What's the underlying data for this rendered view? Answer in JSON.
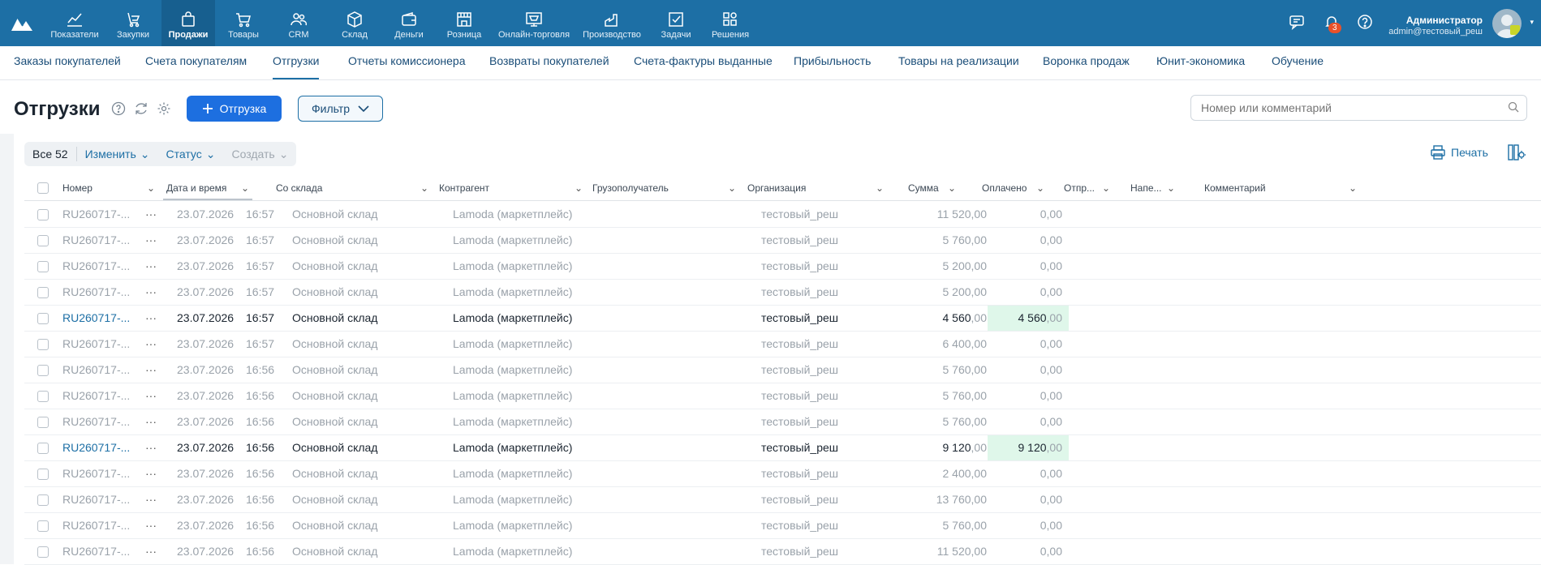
{
  "topnav": {
    "items": [
      {
        "label": "Показатели",
        "icon": "chart-line-icon"
      },
      {
        "label": "Закупки",
        "icon": "purchase-icon"
      },
      {
        "label": "Продажи",
        "icon": "bag-icon"
      },
      {
        "label": "Товары",
        "icon": "cart-icon"
      },
      {
        "label": "CRM",
        "icon": "people-icon"
      },
      {
        "label": "Склад",
        "icon": "box-icon"
      },
      {
        "label": "Деньги",
        "icon": "wallet-icon"
      },
      {
        "label": "Розница",
        "icon": "store-icon"
      },
      {
        "label": "Онлайн-торговля",
        "icon": "online-store-icon"
      },
      {
        "label": "Производство",
        "icon": "factory-icon"
      },
      {
        "label": "Задачи",
        "icon": "checkbox-icon"
      },
      {
        "label": "Решения",
        "icon": "apps-icon"
      }
    ],
    "notifications_count": "3",
    "user_name": "Администратор",
    "user_email": "admin@тестовый_реш"
  },
  "subnav": {
    "items": [
      "Заказы покупателей",
      "Счета покупателям",
      "Отгрузки",
      "Отчеты комиссионера",
      "Возвраты покупателей",
      "Счета-фактуры выданные",
      "Прибыльность",
      "Товары на реализации",
      "Воронка продаж",
      "Юнит-экономика",
      "Обучение"
    ]
  },
  "page": {
    "title": "Отгрузки",
    "add_button": "Отгрузка",
    "filter_button": "Фильтр",
    "search_placeholder": "Номер или комментарий"
  },
  "toolbar": {
    "all_label": "Все 52",
    "edit_label": "Изменить",
    "status_label": "Статус",
    "create_label": "Создать",
    "print_label": "Печать"
  },
  "columns": [
    "Номер",
    "Дата и время",
    "Со склада",
    "Контрагент",
    "Грузополучатель",
    "Организация",
    "Сумма",
    "Оплачено",
    "Отпр...",
    "Напе...",
    "Комментарий"
  ],
  "rows": [
    {
      "number": "RU260717-...",
      "date": "23.07.2026",
      "time": "16:57",
      "warehouse": "Основной склад",
      "counterparty": "Lamoda (маркетплейс)",
      "org": "тестовый_реш",
      "sum_int": "11 520",
      "sum_dec": ",00",
      "paid_int": "0",
      "paid_dec": ",00",
      "highlight": false
    },
    {
      "number": "RU260717-...",
      "date": "23.07.2026",
      "time": "16:57",
      "warehouse": "Основной склад",
      "counterparty": "Lamoda (маркетплейс)",
      "org": "тестовый_реш",
      "sum_int": "5 760",
      "sum_dec": ",00",
      "paid_int": "0",
      "paid_dec": ",00",
      "highlight": false
    },
    {
      "number": "RU260717-...",
      "date": "23.07.2026",
      "time": "16:57",
      "warehouse": "Основной склад",
      "counterparty": "Lamoda (маркетплейс)",
      "org": "тестовый_реш",
      "sum_int": "5 200",
      "sum_dec": ",00",
      "paid_int": "0",
      "paid_dec": ",00",
      "highlight": false
    },
    {
      "number": "RU260717-...",
      "date": "23.07.2026",
      "time": "16:57",
      "warehouse": "Основной склад",
      "counterparty": "Lamoda (маркетплейс)",
      "org": "тестовый_реш",
      "sum_int": "5 200",
      "sum_dec": ",00",
      "paid_int": "0",
      "paid_dec": ",00",
      "highlight": false
    },
    {
      "number": "RU260717-...",
      "date": "23.07.2026",
      "time": "16:57",
      "warehouse": "Основной склад",
      "counterparty": "Lamoda (маркетплейс)",
      "org": "тестовый_реш",
      "sum_int": "4 560",
      "sum_dec": ",00",
      "paid_int": "4 560",
      "paid_dec": ",00",
      "highlight": true
    },
    {
      "number": "RU260717-...",
      "date": "23.07.2026",
      "time": "16:57",
      "warehouse": "Основной склад",
      "counterparty": "Lamoda (маркетплейс)",
      "org": "тестовый_реш",
      "sum_int": "6 400",
      "sum_dec": ",00",
      "paid_int": "0",
      "paid_dec": ",00",
      "highlight": false
    },
    {
      "number": "RU260717-...",
      "date": "23.07.2026",
      "time": "16:56",
      "warehouse": "Основной склад",
      "counterparty": "Lamoda (маркетплейс)",
      "org": "тестовый_реш",
      "sum_int": "5 760",
      "sum_dec": ",00",
      "paid_int": "0",
      "paid_dec": ",00",
      "highlight": false
    },
    {
      "number": "RU260717-...",
      "date": "23.07.2026",
      "time": "16:56",
      "warehouse": "Основной склад",
      "counterparty": "Lamoda (маркетплейс)",
      "org": "тестовый_реш",
      "sum_int": "5 760",
      "sum_dec": ",00",
      "paid_int": "0",
      "paid_dec": ",00",
      "highlight": false
    },
    {
      "number": "RU260717-...",
      "date": "23.07.2026",
      "time": "16:56",
      "warehouse": "Основной склад",
      "counterparty": "Lamoda (маркетплейс)",
      "org": "тестовый_реш",
      "sum_int": "5 760",
      "sum_dec": ",00",
      "paid_int": "0",
      "paid_dec": ",00",
      "highlight": false
    },
    {
      "number": "RU260717-...",
      "date": "23.07.2026",
      "time": "16:56",
      "warehouse": "Основной склад",
      "counterparty": "Lamoda (маркетплейс)",
      "org": "тестовый_реш",
      "sum_int": "9 120",
      "sum_dec": ",00",
      "paid_int": "9 120",
      "paid_dec": ",00",
      "highlight": true
    },
    {
      "number": "RU260717-...",
      "date": "23.07.2026",
      "time": "16:56",
      "warehouse": "Основной склад",
      "counterparty": "Lamoda (маркетплейс)",
      "org": "тестовый_реш",
      "sum_int": "2 400",
      "sum_dec": ",00",
      "paid_int": "0",
      "paid_dec": ",00",
      "highlight": false
    },
    {
      "number": "RU260717-...",
      "date": "23.07.2026",
      "time": "16:56",
      "warehouse": "Основной склад",
      "counterparty": "Lamoda (маркетплейс)",
      "org": "тестовый_реш",
      "sum_int": "13 760",
      "sum_dec": ",00",
      "paid_int": "0",
      "paid_dec": ",00",
      "highlight": false
    },
    {
      "number": "RU260717-...",
      "date": "23.07.2026",
      "time": "16:56",
      "warehouse": "Основной склад",
      "counterparty": "Lamoda (маркетплейс)",
      "org": "тестовый_реш",
      "sum_int": "5 760",
      "sum_dec": ",00",
      "paid_int": "0",
      "paid_dec": ",00",
      "highlight": false
    },
    {
      "number": "RU260717-...",
      "date": "23.07.2026",
      "time": "16:56",
      "warehouse": "Основной склад",
      "counterparty": "Lamoda (маркетплейс)",
      "org": "тестовый_реш",
      "sum_int": "11 520",
      "sum_dec": ",00",
      "paid_int": "0",
      "paid_dec": ",00",
      "highlight": false
    }
  ],
  "colors": {
    "nav_bg": "#1d6fa5",
    "primary": "#1d6fe0",
    "link": "#1d6fa5",
    "paid_highlight": "#dff7ea",
    "badge": "#e8512a"
  }
}
